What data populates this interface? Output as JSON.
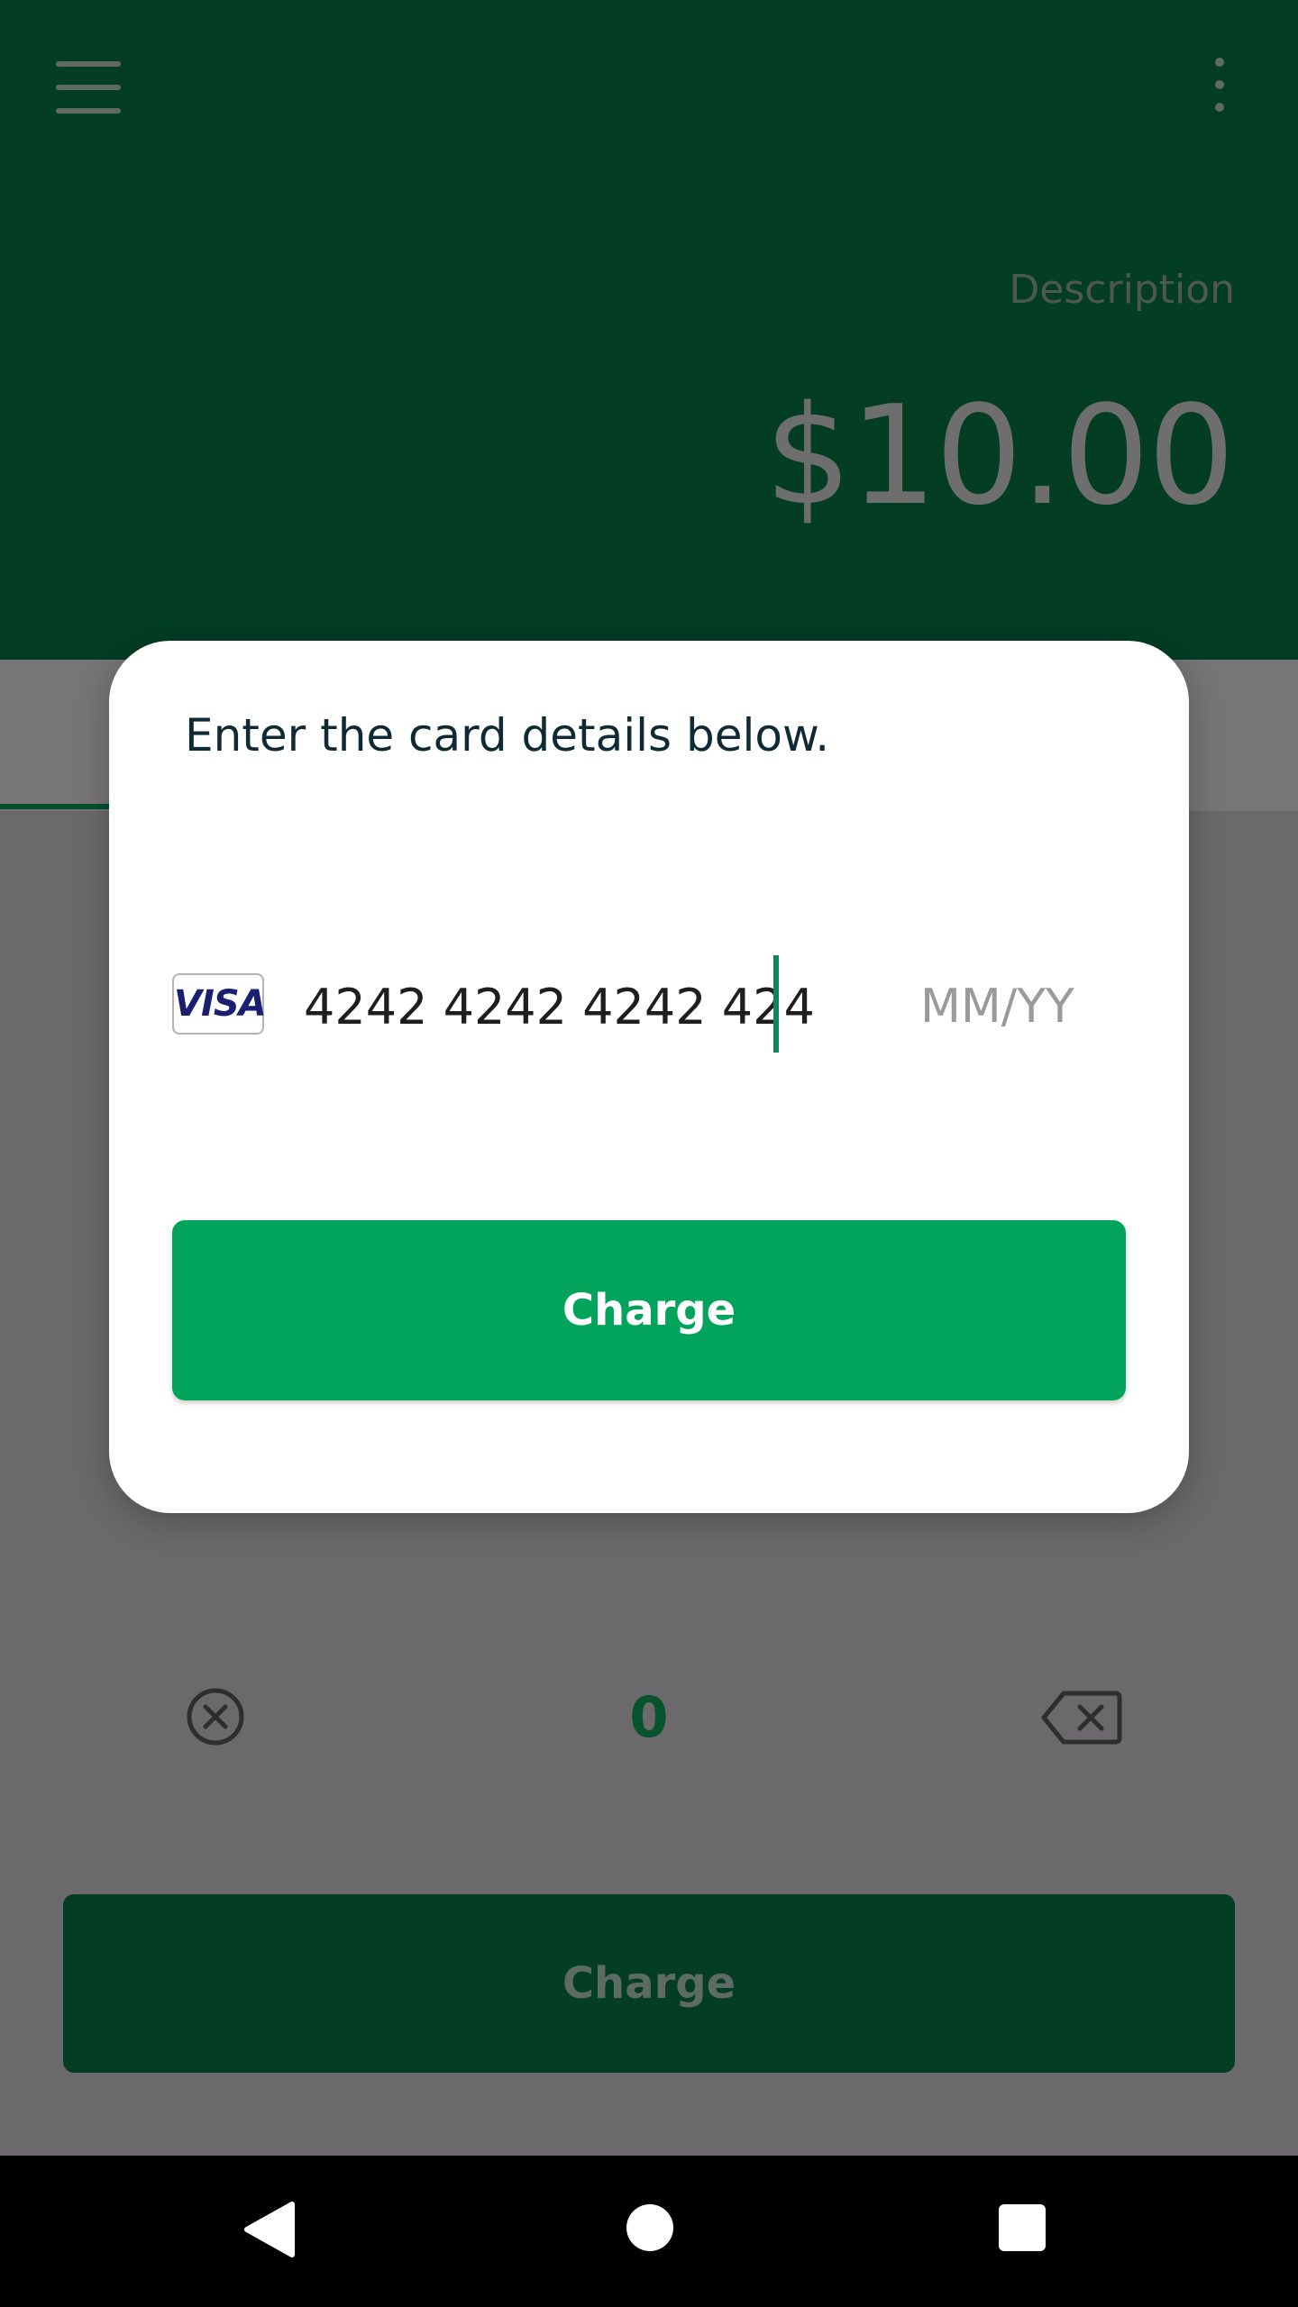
{
  "header": {
    "description_placeholder": "Description",
    "amount": "$10.00",
    "icons": {
      "menu": "hamburger-menu-icon",
      "more": "more-vertical-icon"
    }
  },
  "keypad": {
    "zero_label": "0",
    "icons": {
      "clear": "clear-circle-icon",
      "backspace": "backspace-icon"
    }
  },
  "main_charge_button": {
    "label": "Charge"
  },
  "dialog": {
    "title": "Enter the card details below.",
    "card_brand": "VISA",
    "card_number": "4242 4242 4242 424",
    "expiry_placeholder": "MM/YY",
    "charge_label": "Charge"
  },
  "colors": {
    "header_green": "#033d24",
    "accent_green": "#02a45c",
    "caret": "#12845a",
    "scrim": "#6b696b"
  },
  "navbar": {
    "icons": [
      "back-triangle-icon",
      "home-circle-icon",
      "recents-square-icon"
    ]
  }
}
